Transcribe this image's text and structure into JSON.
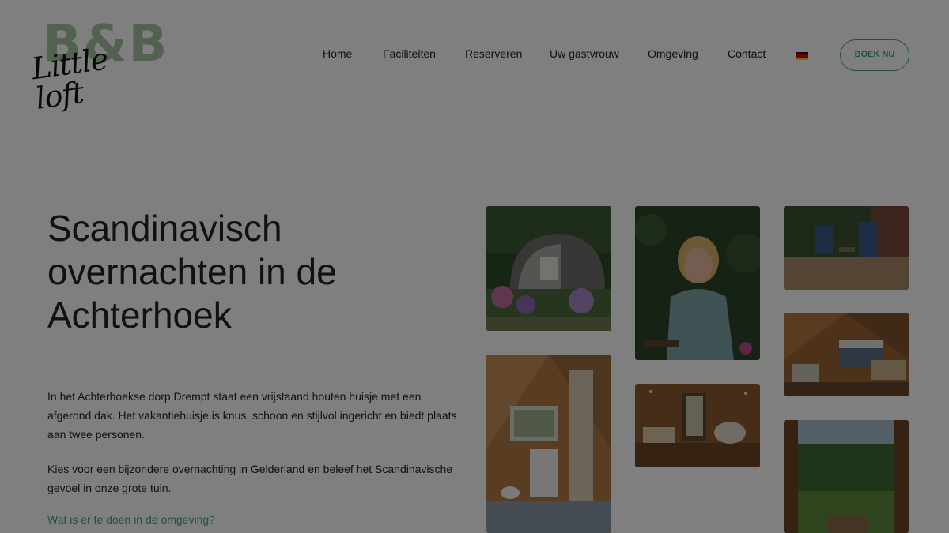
{
  "logo": {
    "bb_text": "B&B",
    "script_text": "Little loft"
  },
  "nav": {
    "items": [
      {
        "label": "Home"
      },
      {
        "label": "Faciliteiten"
      },
      {
        "label": "Reserveren"
      },
      {
        "label": "Uw gastvrouw"
      },
      {
        "label": "Omgeving"
      },
      {
        "label": "Contact"
      }
    ],
    "language_flag": "german-flag-icon",
    "cta_label": "BOEK NU"
  },
  "colors": {
    "accent": "#3fa77a",
    "logo_green": "#a7c2a0"
  },
  "main": {
    "title": "Scandinavisch overnachten in de Achterhoek",
    "paragraph_1": "In het Achterhoekse dorp Drempt staat een vrijstaand houten huisje met een afgerond dak. Het vakantiehuisje is knus, schoon en stijlvol ingericht en biedt plaats aan twee personen.",
    "paragraph_2": "Kies voor een bijzondere overnachting in Gelderland en beleef het Scandinavische gevoel in onze grote tuin.",
    "link_text": "Wat is er te doen in de omgeving?"
  }
}
